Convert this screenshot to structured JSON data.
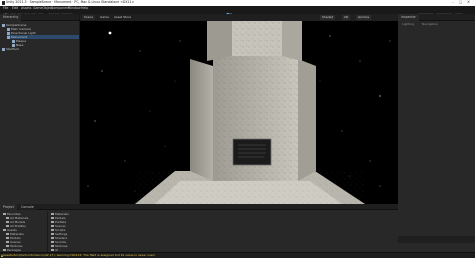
{
  "window": {
    "title": "Unity 2021.3 · SampleScene · Monument · PC, Mac & Linux Standalone <DX11>",
    "controls": [
      "–",
      "□",
      "✕"
    ]
  },
  "menu": [
    "File",
    "Edit",
    "Assets",
    "GameObject",
    "Component",
    "Window",
    "Help"
  ],
  "toolbar": {
    "tools": [
      "Hand",
      "Move",
      "Rotate",
      "Scale",
      "Rect",
      "Transform"
    ],
    "pivot": "Pivot",
    "space": "Global",
    "play": "▶",
    "pause": "❚❚",
    "step": "▶|",
    "right": [
      "Layers",
      "Layout"
    ]
  },
  "hierarchy": {
    "tab": "Hierarchy",
    "items": [
      {
        "label": "SampleScene",
        "indent": 0
      },
      {
        "label": "Main Camera",
        "indent": 1
      },
      {
        "label": "Directional Light",
        "indent": 1
      },
      {
        "label": "Monument",
        "indent": 1
      },
      {
        "label": "Plaque",
        "indent": 2
      },
      {
        "label": "Base",
        "indent": 2
      },
      {
        "label": "Starfield",
        "indent": 0
      }
    ]
  },
  "scene_view": {
    "tabs": [
      "Scene",
      "Game",
      "Asset Store"
    ],
    "controls": [
      "Shaded",
      "2D",
      "Gizmos"
    ]
  },
  "inspector": {
    "tab": "Inspector",
    "sub": [
      "Lighting",
      "Navigation"
    ]
  },
  "project": {
    "tabs": [
      "Project",
      "Console"
    ],
    "folders": [
      "Favorites",
      "All Materials",
      "All Models",
      "All Prefabs",
      "Assets",
      "Materials",
      "Models",
      "Scenes",
      "Textures",
      "Packages"
    ],
    "assets": [
      "Materials",
      "Models",
      "Prefabs",
      "Scenes",
      "Scripts",
      "Settings",
      "Shaders",
      "Sounds",
      "Textures",
      "UI"
    ]
  },
  "status": {
    "message": "Assets/Scripts/Controller.cs(42,17): warning CS0414: The field is assigned but its value is never used"
  }
}
